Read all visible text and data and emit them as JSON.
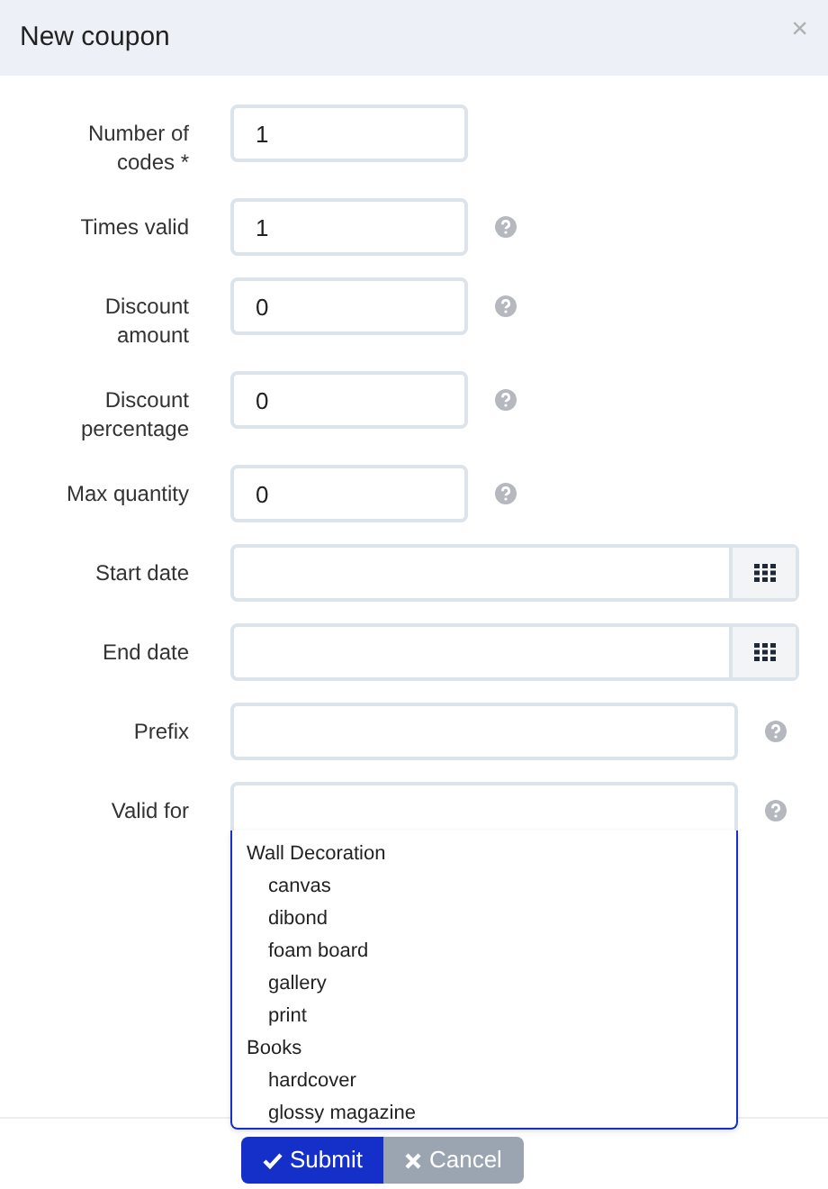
{
  "dialog": {
    "title": "New coupon",
    "close": "×"
  },
  "fields": [
    {
      "label": "Number of codes *",
      "kind": "short",
      "value": "1",
      "help": false
    },
    {
      "label": "Times valid",
      "kind": "short",
      "value": "1",
      "help": true
    },
    {
      "label": "Discount amount",
      "kind": "short",
      "value": "0",
      "help": true
    },
    {
      "label": "Discount percentage",
      "kind": "short",
      "value": "0",
      "help": true
    },
    {
      "label": "Max quantity",
      "kind": "short",
      "value": "0",
      "help": true
    },
    {
      "label": "Start date",
      "kind": "date",
      "help": false
    },
    {
      "label": "End date",
      "kind": "date",
      "help": false
    },
    {
      "label": "Prefix",
      "kind": "wide",
      "help": true
    },
    {
      "label": "Valid for",
      "kind": "select",
      "help": true
    }
  ],
  "dropdown": [
    {
      "label": "Wall Decoration",
      "children": [
        {
          "label": "canvas"
        },
        {
          "label": "dibond"
        },
        {
          "label": "foam board"
        },
        {
          "label": "gallery"
        },
        {
          "label": "print"
        }
      ]
    },
    {
      "label": "Books",
      "children": [
        {
          "label": "hardcover"
        },
        {
          "label": "glossy magazine"
        }
      ]
    }
  ],
  "buttons": [
    {
      "label": "Submit",
      "kind": "primary"
    },
    {
      "label": "Cancel",
      "kind": "secondary"
    }
  ]
}
